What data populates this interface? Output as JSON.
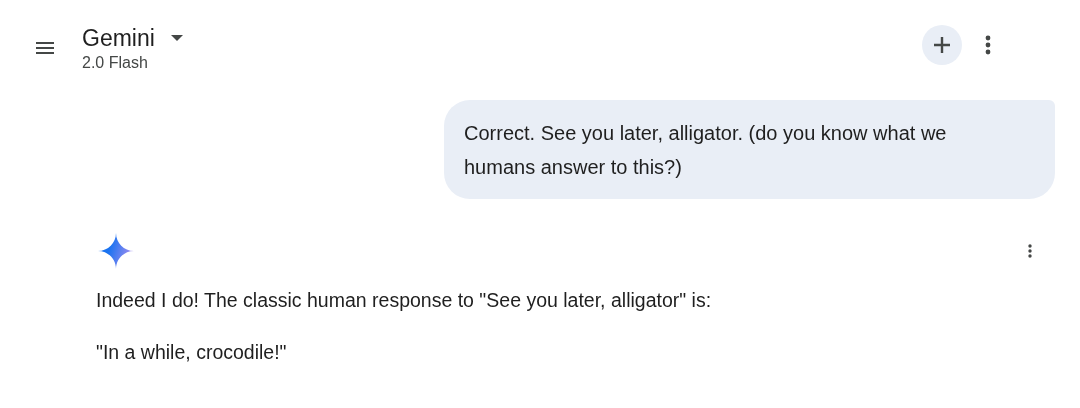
{
  "header": {
    "title": "Gemini",
    "subtitle": "2.0 Flash"
  },
  "messages": [
    {
      "kind": "user",
      "text": "Correct. See you later, alligator. (do you know what we humans answer to this?)"
    },
    {
      "kind": "model",
      "paragraphs": [
        "Indeed I do! The classic human response to \"See you later, alligator\" is:",
        "\"In a while, crocodile!\""
      ]
    }
  ]
}
